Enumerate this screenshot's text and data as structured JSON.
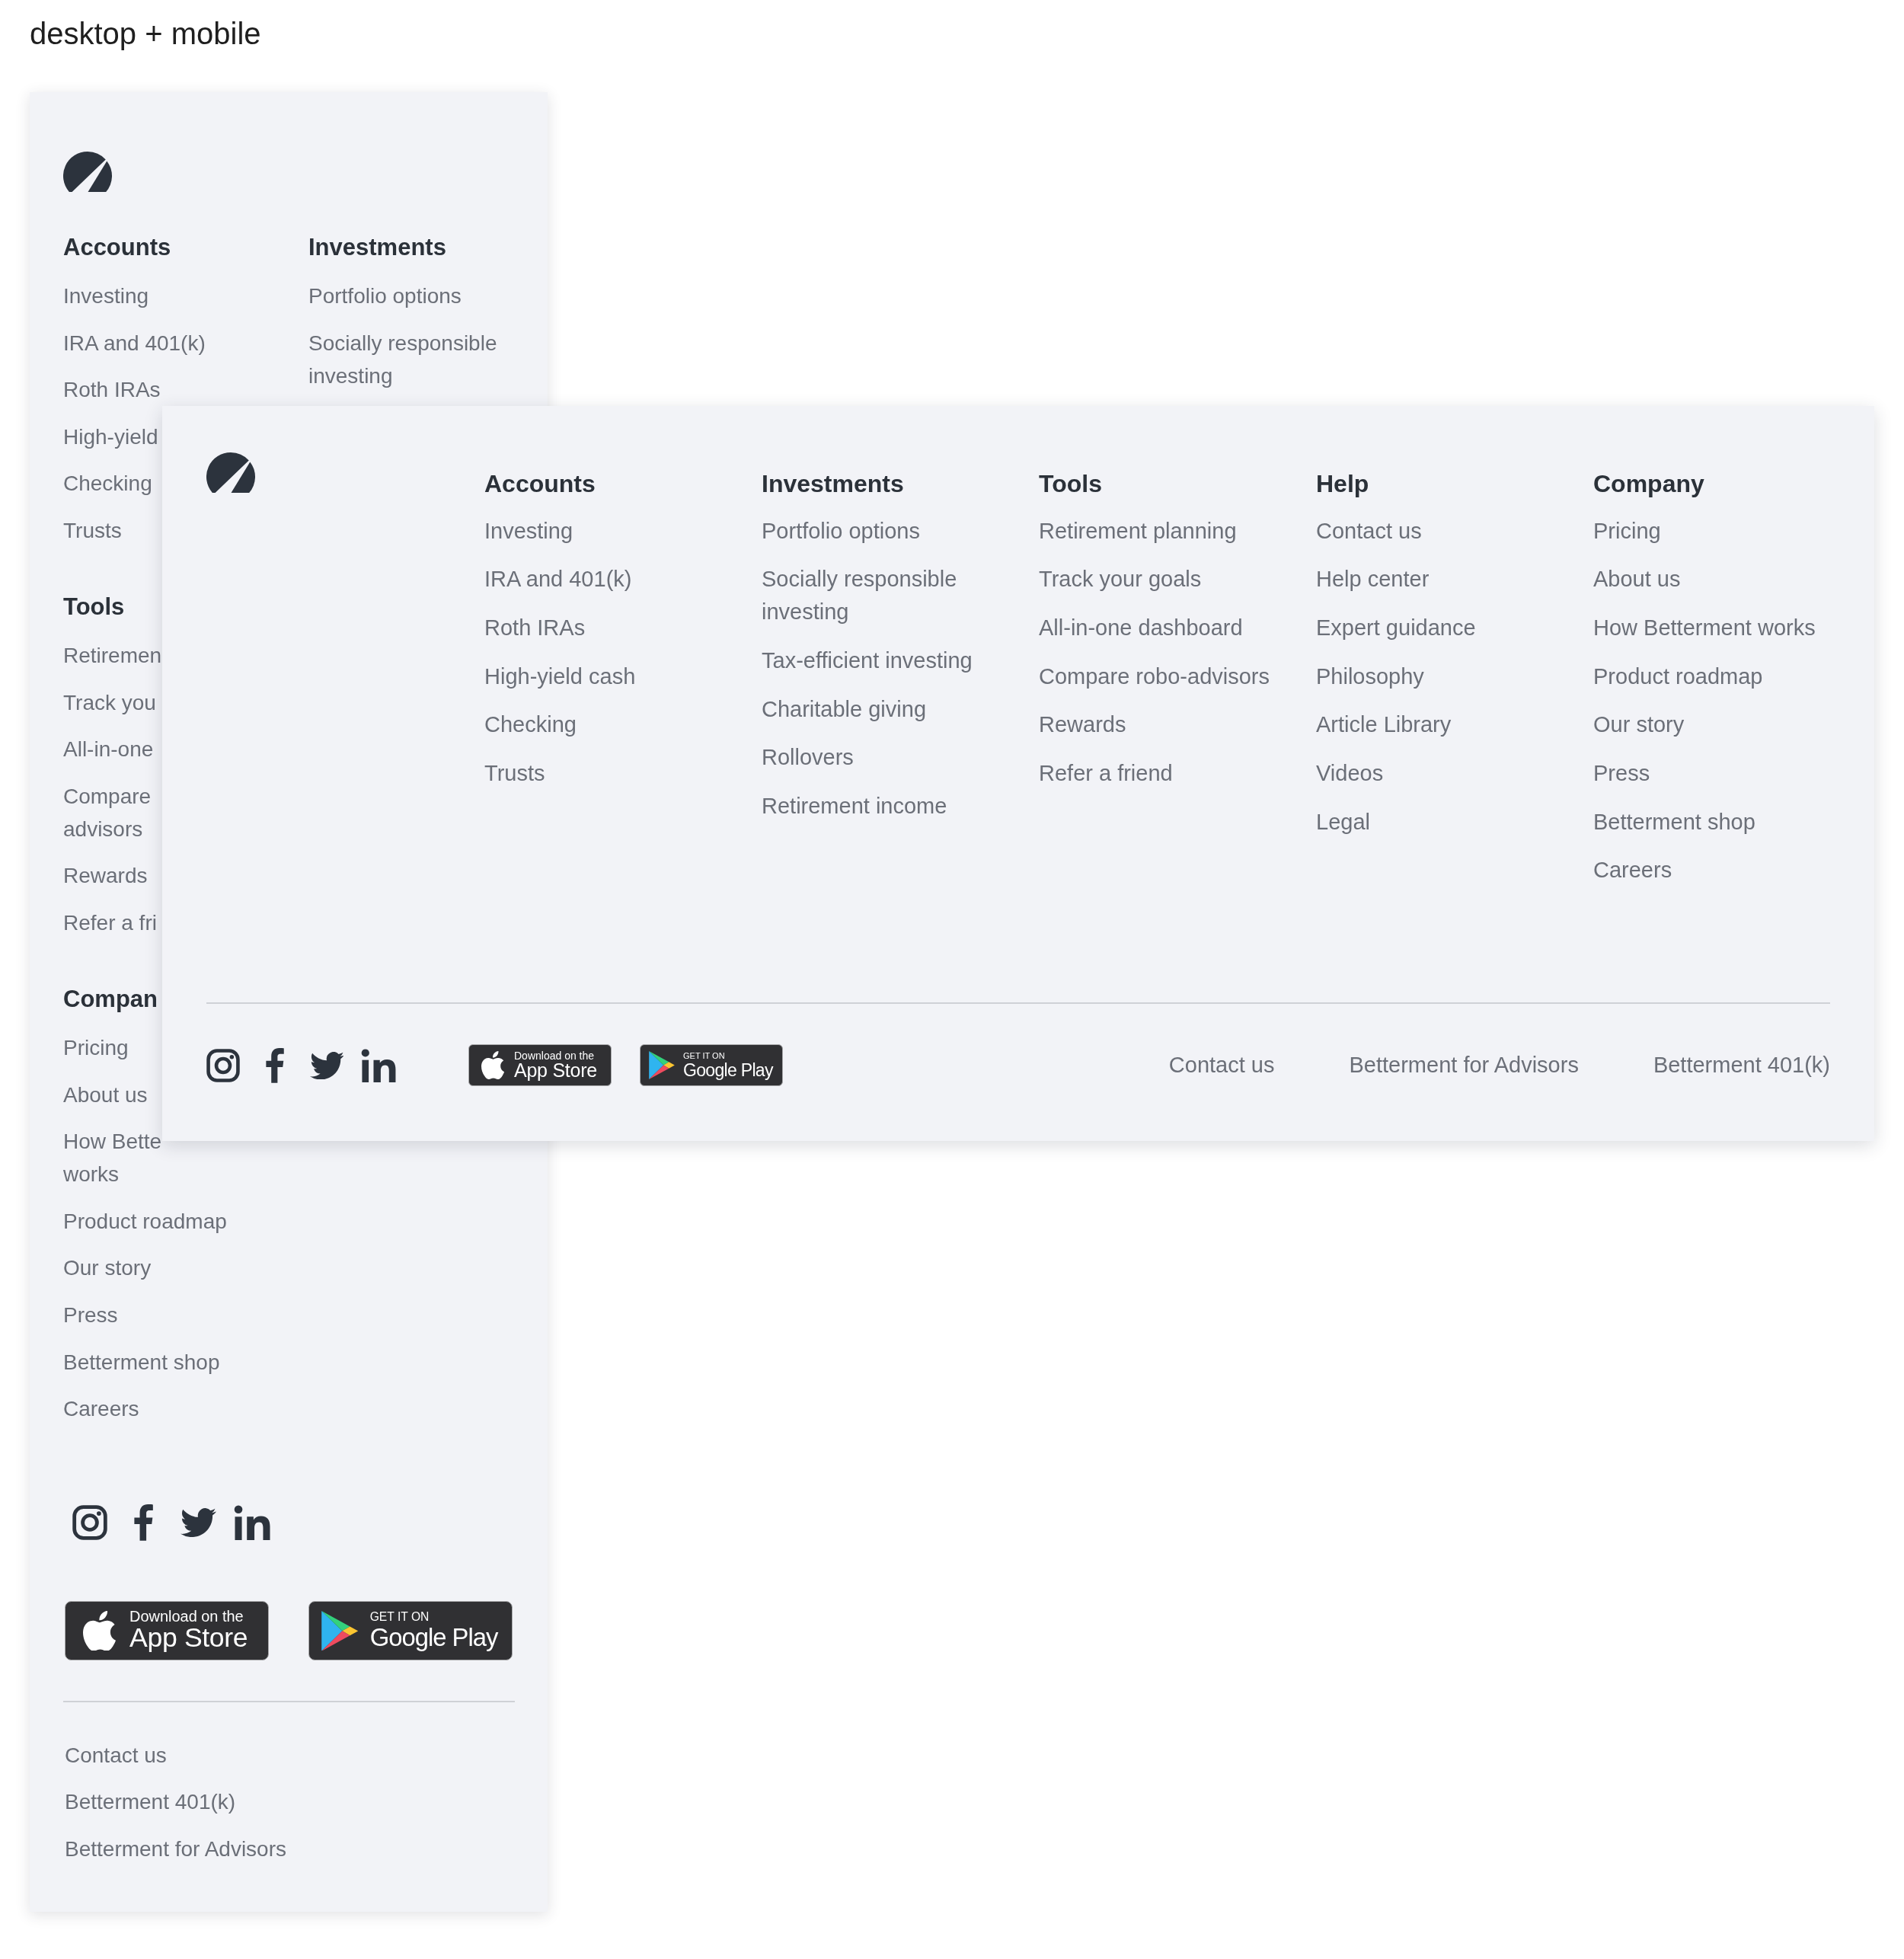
{
  "title": "desktop + mobile",
  "mobile": {
    "rows": [
      [
        {
          "heading": "Accounts",
          "links": [
            "Investing",
            "IRA and 401(k)",
            "Roth IRAs",
            "High-yield",
            "Checking",
            "Trusts"
          ]
        },
        {
          "heading": "Investments",
          "links": [
            "Portfolio options",
            "Socially responsible investing"
          ]
        }
      ],
      [
        {
          "heading": "Tools",
          "links": [
            "Retiremen",
            "Track you",
            "All-in-one",
            "Compare\nadvisors",
            "Rewards",
            "Refer a fri"
          ]
        }
      ],
      [
        {
          "heading": "Compan",
          "links": [
            "Pricing",
            "About us",
            "How Bette\nworks",
            "Product roadmap",
            "Our story",
            "Press",
            "Betterment shop",
            "Careers"
          ]
        }
      ]
    ],
    "badges": [
      {
        "kind": "app-store",
        "small": "Download on the",
        "large": "App Store"
      },
      {
        "kind": "google-play",
        "small": "GET IT ON",
        "large": "Google Play"
      }
    ],
    "bottom_links": [
      "Contact us",
      "Betterment 401(k)",
      "Betterment for Advisors"
    ]
  },
  "desktop": {
    "columns": [
      {
        "heading": "Accounts",
        "links": [
          "Investing",
          "IRA and 401(k)",
          "Roth IRAs",
          "High-yield cash",
          "Checking",
          "Trusts"
        ]
      },
      {
        "heading": "Investments",
        "links": [
          "Portfolio options",
          "Socially responsible investing",
          "Tax-efficient investing",
          "Charitable giving",
          "Rollovers",
          "Retirement income"
        ]
      },
      {
        "heading": "Tools",
        "links": [
          "Retirement planning",
          "Track your goals",
          "All-in-one dashboard",
          "Compare robo-advisors",
          "Rewards",
          "Refer a friend"
        ]
      },
      {
        "heading": "Help",
        "links": [
          "Contact us",
          "Help center",
          "Expert guidance",
          "Philosophy",
          "Article Library",
          "Videos",
          "Legal"
        ]
      },
      {
        "heading": "Company",
        "links": [
          "Pricing",
          "About us",
          "How Betterment works",
          "Product roadmap",
          "Our story",
          "Press",
          "Betterment shop",
          "Careers"
        ]
      }
    ],
    "badges": [
      {
        "kind": "app-store",
        "small": "Download on the",
        "large": "App Store"
      },
      {
        "kind": "google-play",
        "small": "GET IT ON",
        "large": "Google Play"
      }
    ],
    "bottom_links": [
      "Contact us",
      "Betterment for Advisors",
      "Betterment 401(k)"
    ]
  }
}
